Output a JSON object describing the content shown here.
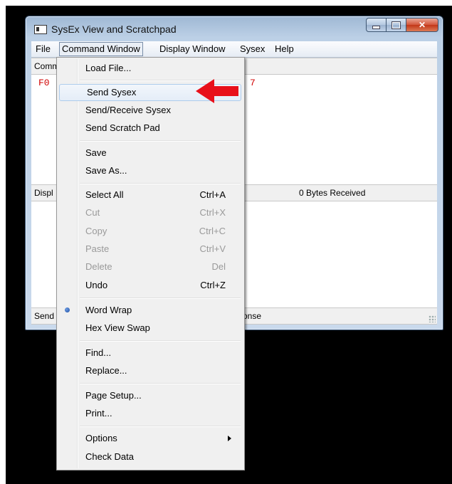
{
  "window": {
    "title": "SysEx View and Scratchpad"
  },
  "menubar": {
    "items": [
      "File",
      "Command Window",
      "Display Window",
      "Sysex",
      "Help"
    ],
    "open_item": "Command Window"
  },
  "panels": {
    "command_label": "Comm",
    "command_hex_left": "F0",
    "command_hex_right": "7",
    "display_label": "Displ",
    "bytes_received": "0  Bytes Received",
    "send_label": "Send",
    "response_label": "onse"
  },
  "context_menu": {
    "items": [
      {
        "label": "Load File...",
        "shortcut": "",
        "disabled": false
      },
      {
        "label": "Send Sysex",
        "shortcut": "",
        "disabled": false,
        "highlighted": true
      },
      {
        "label": "Send/Receive Sysex",
        "shortcut": "",
        "disabled": false
      },
      {
        "label": "Send Scratch Pad",
        "shortcut": "",
        "disabled": false
      },
      {
        "label": "Save",
        "shortcut": "",
        "disabled": false
      },
      {
        "label": "Save As...",
        "shortcut": "",
        "disabled": false
      },
      {
        "label": "Select All",
        "shortcut": "Ctrl+A",
        "disabled": false
      },
      {
        "label": "Cut",
        "shortcut": "Ctrl+X",
        "disabled": true
      },
      {
        "label": "Copy",
        "shortcut": "Ctrl+C",
        "disabled": true
      },
      {
        "label": "Paste",
        "shortcut": "Ctrl+V",
        "disabled": true
      },
      {
        "label": "Delete",
        "shortcut": "Del",
        "disabled": true
      },
      {
        "label": "Undo",
        "shortcut": "Ctrl+Z",
        "disabled": false
      },
      {
        "label": "Word Wrap",
        "shortcut": "",
        "disabled": false,
        "checked": true
      },
      {
        "label": "Hex View Swap",
        "shortcut": "",
        "disabled": false
      },
      {
        "label": "Find...",
        "shortcut": "",
        "disabled": false
      },
      {
        "label": "Replace...",
        "shortcut": "",
        "disabled": false
      },
      {
        "label": "Page Setup...",
        "shortcut": "",
        "disabled": false
      },
      {
        "label": "Print...",
        "shortcut": "",
        "disabled": false
      },
      {
        "label": "Options",
        "shortcut": "",
        "disabled": false,
        "submenu": true
      },
      {
        "label": "Check Data",
        "shortcut": "",
        "disabled": false
      }
    ]
  },
  "colors": {
    "annotation_arrow": "#e8101a",
    "hex_text": "#d00000"
  }
}
